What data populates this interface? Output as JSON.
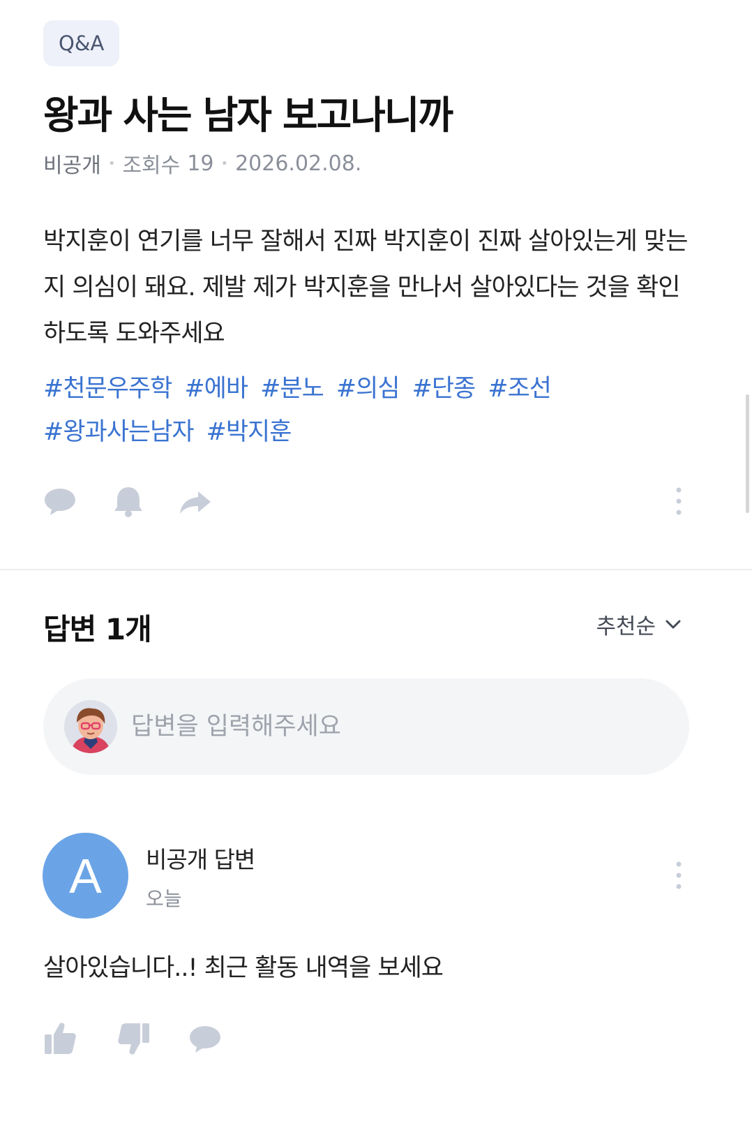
{
  "question": {
    "category_badge": "Q&A",
    "title": "왕과 사는 남자 보고나니까",
    "author": "비공개",
    "views_label": "조회수",
    "views": "19",
    "date": "2026.02.08.",
    "body": "박지훈이 연기를 너무 잘해서 진짜 박지훈이 진짜 살아있는게 맞는지 의심이 돼요. 제발 제가 박지훈을 만나서 살아있다는 것을 확인하도록 도와주세요",
    "tags": [
      "#천문우주학",
      "#에바",
      "#분노",
      "#의심",
      "#단종",
      "#조선",
      "#왕과사는남자",
      "#박지훈"
    ],
    "actions": [
      "comment-icon",
      "bell-icon",
      "share-icon",
      "more-vertical-icon"
    ]
  },
  "answers_section": {
    "header": "답변 1개",
    "sort_label": "추천순",
    "input_placeholder": "답변을 입력해주세요"
  },
  "answer": {
    "avatar_letter": "A",
    "author": "비공개 답변",
    "time": "오늘",
    "text": "살아있습니다..! 최근 활동 내역을 보세요",
    "actions": [
      "thumbs-up-icon",
      "thumbs-down-icon",
      "comment-icon"
    ]
  },
  "colors": {
    "tag": "#3a73d1",
    "icon_gray": "#c8ced9",
    "badge_bg": "#eef1f9",
    "avatar_bg": "#6aa4e6"
  }
}
